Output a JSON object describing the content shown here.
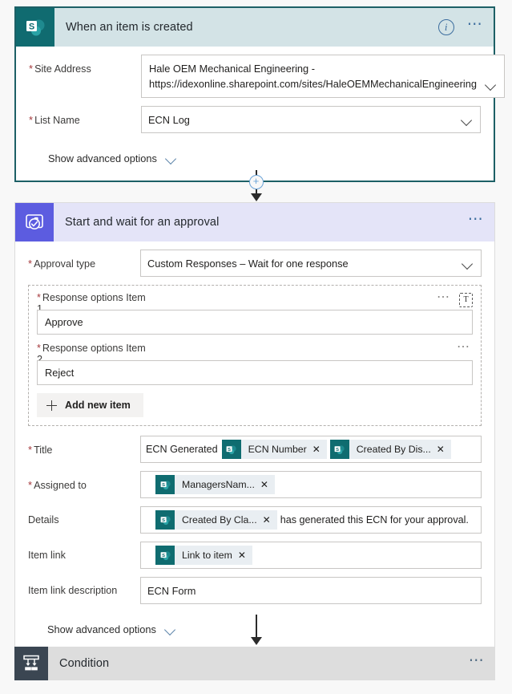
{
  "trigger": {
    "icon": "sharepoint-icon",
    "title": "When an item is created",
    "info_icon": "info-icon",
    "more_icon": "more-options-icon",
    "fields": [
      {
        "label": "Site Address",
        "required": true,
        "value_line1": "Hale OEM Mechanical Engineering -",
        "value_line2": "https://idexonline.sharepoint.com/sites/HaleOEMMechanicalEngineering"
      },
      {
        "label": "List Name",
        "required": true,
        "value": "ECN Log"
      }
    ],
    "advanced_label": "Show advanced options"
  },
  "connector1": {
    "plus_label": "+",
    "plus_icon": "add-step-icon"
  },
  "approval": {
    "icon": "approvals-icon",
    "title": "Start and wait for an approval",
    "more_icon": "more-options-icon",
    "approval_type": {
      "label": "Approval type",
      "required": true,
      "value": "Custom Responses – Wait for one response"
    },
    "response_options": [
      {
        "label": "Response options Item",
        "index": "1",
        "required": true,
        "value": "Approve",
        "more_icon": "more-options-icon",
        "picker_icon": "dynamic-content-icon"
      },
      {
        "label": "Response options Item",
        "index": "2",
        "required": true,
        "value": "Reject",
        "more_icon": "more-options-icon"
      }
    ],
    "add_new_item_label": "Add new item",
    "title_field": {
      "label": "Title",
      "required": true,
      "parts": [
        {
          "kind": "text",
          "text": "ECN Generated"
        },
        {
          "kind": "token",
          "text": "ECN Number"
        },
        {
          "kind": "token",
          "text": "Created By Dis..."
        }
      ]
    },
    "assigned_to": {
      "label": "Assigned to",
      "required": true,
      "parts": [
        {
          "kind": "token",
          "text": "ManagersNam..."
        }
      ]
    },
    "details": {
      "label": "Details",
      "required": false,
      "parts": [
        {
          "kind": "token",
          "text": "Created By Cla..."
        },
        {
          "kind": "text",
          "text": "has generated this ECN for your approval."
        }
      ]
    },
    "item_link": {
      "label": "Item link",
      "required": false,
      "parts": [
        {
          "kind": "token",
          "text": "Link to item"
        }
      ]
    },
    "item_link_description": {
      "label": "Item link description",
      "required": false,
      "value": "ECN Form"
    },
    "advanced_label": "Show advanced options"
  },
  "condition": {
    "icon": "condition-icon",
    "title": "Condition",
    "more_icon": "more-options-icon"
  },
  "colors": {
    "sharepoint_teal": "#106b70",
    "trigger_header": "#d3e3e6",
    "trigger_border": "#1d6066",
    "approval_purple": "#5c5ce0",
    "approval_header": "#e4e4f8",
    "condition_slate": "#3b4652",
    "condition_header": "#dddddd",
    "required_red": "#a4373a",
    "accent_blue": "#3c6d9e",
    "token_bg": "#e9eef2",
    "page_bg": "#f8f8f8"
  }
}
